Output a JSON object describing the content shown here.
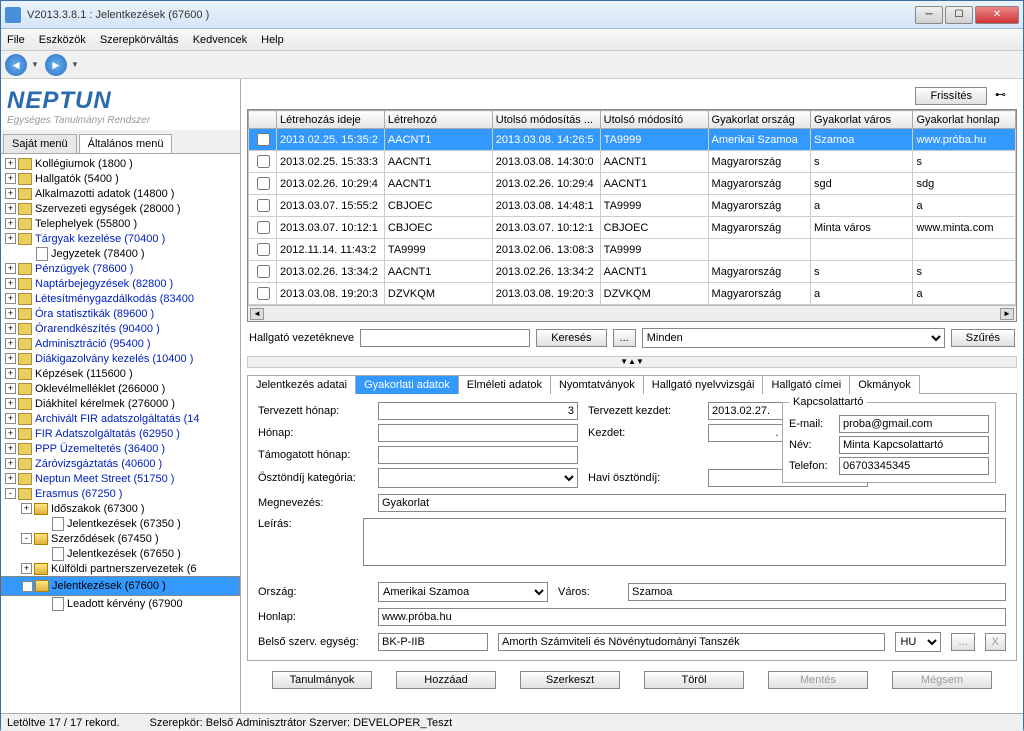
{
  "window": {
    "title": "V2013.3.8.1 : Jelentkezések (67600 )"
  },
  "menu": {
    "file": "File",
    "tools": "Eszközök",
    "role": "Szerepkörváltás",
    "fav": "Kedvencek",
    "help": "Help"
  },
  "logo": {
    "main": "NEPTUN",
    "sub": "Egységes Tanulmányi Rendszer"
  },
  "lefttabs": {
    "own": "Saját menü",
    "general": "Általános menü"
  },
  "tree": [
    {
      "l": 0,
      "e": "+",
      "i": "t",
      "t": "Kollégiumok (1800 )"
    },
    {
      "l": 0,
      "e": "+",
      "i": "t",
      "t": "Hallgatók (5400 )"
    },
    {
      "l": 0,
      "e": "+",
      "i": "t",
      "t": "Alkalmazotti adatok (14800 )"
    },
    {
      "l": 0,
      "e": "+",
      "i": "t",
      "t": "Szervezeti egységek (28000 )"
    },
    {
      "l": 0,
      "e": "+",
      "i": "t",
      "t": "Telephelyek (55800 )"
    },
    {
      "l": 0,
      "e": "+",
      "i": "t",
      "t": "Tárgyak kezelése (70400 )",
      "link": 1
    },
    {
      "l": 1,
      "e": "",
      "i": "l",
      "t": "Jegyzetek (78400 )"
    },
    {
      "l": 0,
      "e": "+",
      "i": "t",
      "t": "Pénzügyek (78600 )",
      "link": 1
    },
    {
      "l": 0,
      "e": "+",
      "i": "t",
      "t": "Naptárbejegyzések (82800 )",
      "link": 1
    },
    {
      "l": 0,
      "e": "+",
      "i": "t",
      "t": "Létesítménygazdálkodás (83400",
      "link": 1
    },
    {
      "l": 0,
      "e": "+",
      "i": "t",
      "t": "Óra statisztikák (89600 )",
      "link": 1
    },
    {
      "l": 0,
      "e": "+",
      "i": "t",
      "t": "Órarendkészítés (90400 )",
      "link": 1
    },
    {
      "l": 0,
      "e": "+",
      "i": "t",
      "t": "Adminisztráció (95400 )",
      "link": 1
    },
    {
      "l": 0,
      "e": "+",
      "i": "t",
      "t": "Diákigazolvány kezelés (10400 )",
      "link": 1
    },
    {
      "l": 0,
      "e": "+",
      "i": "t",
      "t": "Képzések (115600 )"
    },
    {
      "l": 0,
      "e": "+",
      "i": "t",
      "t": "Oklevélmelléklet (266000 )"
    },
    {
      "l": 0,
      "e": "+",
      "i": "t",
      "t": "Diákhitel kérelmek (276000 )"
    },
    {
      "l": 0,
      "e": "+",
      "i": "t",
      "t": "Archivált FIR adatszolgáltatás (14",
      "link": 1
    },
    {
      "l": 0,
      "e": "+",
      "i": "t",
      "t": "FIR Adatszolgáltatás (62950 )",
      "link": 1
    },
    {
      "l": 0,
      "e": "+",
      "i": "t",
      "t": "PPP Üzemeltetés (36400 )",
      "link": 1
    },
    {
      "l": 0,
      "e": "+",
      "i": "t",
      "t": "Záróvizsgáztatás (40600 )",
      "link": 1
    },
    {
      "l": 0,
      "e": "+",
      "i": "t",
      "t": "Neptun Meet Street (51750 )",
      "link": 1
    },
    {
      "l": 0,
      "e": "-",
      "i": "t",
      "t": "Erasmus (67250 )",
      "link": 1
    },
    {
      "l": 1,
      "e": "+",
      "i": "f",
      "t": "Időszakok (67300 )"
    },
    {
      "l": 2,
      "e": "",
      "i": "l",
      "t": "Jelentkezések (67350 )"
    },
    {
      "l": 1,
      "e": "-",
      "i": "f",
      "t": "Szerződések (67450 )"
    },
    {
      "l": 2,
      "e": "",
      "i": "l",
      "t": "Jelentkezések (67650 )"
    },
    {
      "l": 1,
      "e": "+",
      "i": "f",
      "t": "Külföldi partnerszervezetek (6"
    },
    {
      "l": 1,
      "e": "-",
      "i": "f",
      "t": "Jelentkezések (67600 )",
      "sel": 1
    },
    {
      "l": 2,
      "e": "",
      "i": "l",
      "t": "Leadott kérvény (67900 "
    }
  ],
  "topbuttons": {
    "refresh": "Frissítés"
  },
  "grid": {
    "cols": [
      "",
      "Létrehozás ideje",
      "Létrehozó",
      "Utolsó módosítás ...",
      "Utolsó módosító",
      "Gyakorlat ország",
      "Gyakorlat város",
      "Gyakorlat honlap"
    ],
    "rows": [
      {
        "sel": 1,
        "c": [
          "2013.02.25. 15:35:2",
          "AACNT1",
          "2013.03.08. 14:26:5",
          "TA9999",
          "Amerikai Szamoa",
          "Szamoa",
          "www.próba.hu"
        ]
      },
      {
        "c": [
          "2013.02.25. 15:33:3",
          "AACNT1",
          "2013.03.08. 14:30:0",
          "AACNT1",
          "Magyarország",
          "s",
          "s"
        ]
      },
      {
        "c": [
          "2013.02.26. 10:29:4",
          "AACNT1",
          "2013.02.26. 10:29:4",
          "AACNT1",
          "Magyarország",
          "sgd",
          "sdg"
        ]
      },
      {
        "c": [
          "2013.03.07. 15:55:2",
          "CBJOEC",
          "2013.03.08. 14:48:1",
          "TA9999",
          "Magyarország",
          "a",
          "a"
        ]
      },
      {
        "c": [
          "2013.03.07. 10:12:1",
          "CBJOEC",
          "2013.03.07. 10:12:1",
          "CBJOEC",
          "Magyarország",
          "Minta város",
          "www.minta.com"
        ]
      },
      {
        "c": [
          "2012.11.14. 11:43:2",
          "TA9999",
          "2013.02.06. 13:08:3",
          "TA9999",
          "",
          "",
          ""
        ]
      },
      {
        "c": [
          "2013.02.26. 13:34:2",
          "AACNT1",
          "2013.02.26. 13:34:2",
          "AACNT1",
          "Magyarország",
          "s",
          "s"
        ]
      },
      {
        "c": [
          "2013.03.08. 19:20:3",
          "DZVKQM",
          "2013.03.08. 19:20:3",
          "DZVKQM",
          "Magyarország",
          "a",
          "a"
        ]
      }
    ]
  },
  "search": {
    "label": "Hallgató vezetékneve",
    "btn": "Keresés",
    "dots": "...",
    "all": "Minden",
    "filter": "Szűrés"
  },
  "tabs": {
    "t1": "Jelentkezés adatai",
    "t2": "Gyakorlati adatok",
    "t3": "Elméleti adatok",
    "t4": "Nyomtatványok",
    "t5": "Hallgató nyelvvizsgái",
    "t6": "Hallgató címei",
    "t7": "Okmányok"
  },
  "form": {
    "terv_honap": "Tervezett hónap:",
    "terv_honap_v": "3",
    "honap": "Hónap:",
    "tam_honap": "Támogatott hónap:",
    "oszt_kat": "Ösztöndíj kategória:",
    "terv_kezdet": "Tervezett kezdet:",
    "terv_kezdet_v": "2013.02.27.",
    "kezdet": "Kezdet:",
    "kezdet_v": ". . .",
    "havi": "Havi ösztöndíj:",
    "megnev": "Megnevezés:",
    "megnev_v": "Gyakorlat",
    "leiras": "Leírás:",
    "orszag": "Ország:",
    "orszag_v": "Amerikai Szamoa",
    "varos": "Város:",
    "varos_v": "Szamoa",
    "honlap": "Honlap:",
    "honlap_v": "www.próba.hu",
    "belso": "Belső szerv. egység:",
    "belso1": "BK-P-IIB",
    "belso2": "Amorth Számviteli és Növénytudományi Tanszék",
    "lang": "HU",
    "dots": "...",
    "xbtn": "X"
  },
  "kapcs": {
    "legend": "Kapcsolattartó",
    "email_l": "E-mail:",
    "email_v": "proba@gmail.com",
    "nev_l": "Név:",
    "nev_v": "Minta Kapcsolattartó",
    "tel_l": "Telefon:",
    "tel_v": "06703345345"
  },
  "btns": {
    "tanul": "Tanulmányok",
    "add": "Hozzáad",
    "edit": "Szerkeszt",
    "del": "Töröl",
    "save": "Mentés",
    "cancel": "Mégsem"
  },
  "status": {
    "rec": "Letöltve 17 / 17 rekord.",
    "role": "Szerepkör: Belső Adminisztrátor  Szerver: DEVELOPER_Teszt"
  }
}
